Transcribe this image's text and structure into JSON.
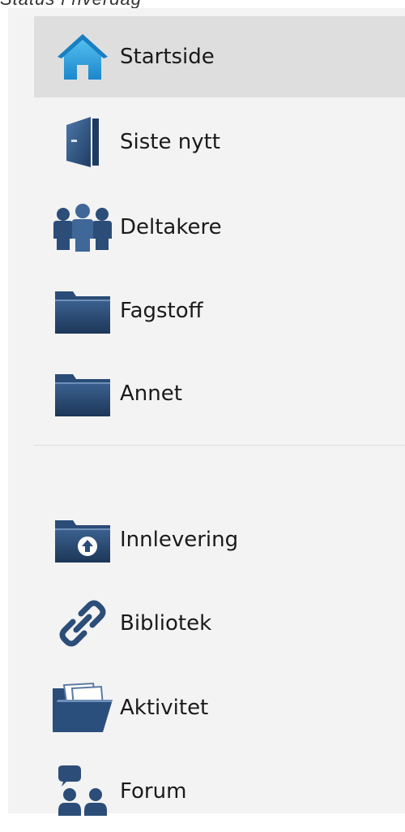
{
  "caption": "Status i hverdag",
  "nav": {
    "items": [
      {
        "label": "Startside",
        "icon": "home-icon",
        "active": true
      },
      {
        "label": "Siste nytt",
        "icon": "door-icon"
      },
      {
        "label": "Deltakere",
        "icon": "people-icon"
      },
      {
        "label": "Fagstoff",
        "icon": "folder-icon"
      },
      {
        "label": "Annet",
        "icon": "folder-icon"
      }
    ],
    "tools": [
      {
        "label": "Innlevering",
        "icon": "upload-folder-icon"
      },
      {
        "label": "Bibliotek",
        "icon": "link-icon"
      },
      {
        "label": "Aktivitet",
        "icon": "open-folder-icon"
      },
      {
        "label": "Forum",
        "icon": "forum-icon"
      }
    ]
  },
  "colors": {
    "active_bg": "#dedede",
    "icon_blue": "#2c4d78",
    "home_blue": "#29a6e6"
  }
}
